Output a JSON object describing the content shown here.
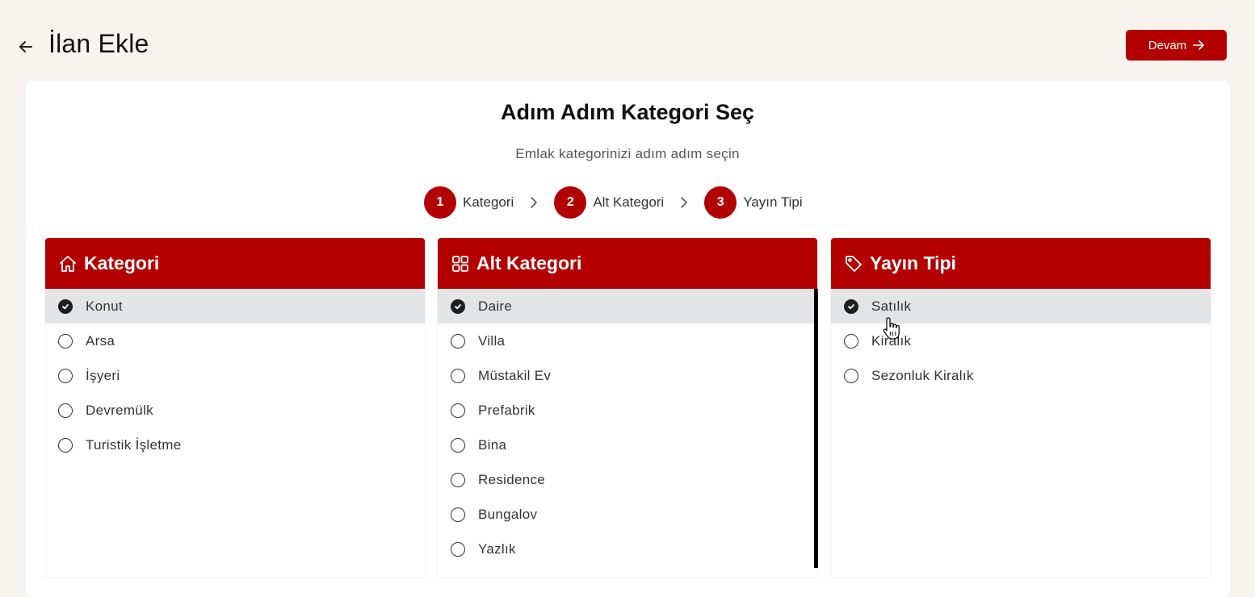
{
  "header": {
    "title": "İlan Ekle",
    "continue_label": "Devam"
  },
  "intro": {
    "heading": "Adım Adım Kategori Seç",
    "subheading": "Emlak kategorinizi adım adım seçin"
  },
  "steps": [
    {
      "number": "1",
      "label": "Kategori"
    },
    {
      "number": "2",
      "label": "Alt Kategori"
    },
    {
      "number": "3",
      "label": "Yayın Tipi"
    }
  ],
  "panels": {
    "category": {
      "title": "Kategori",
      "icon": "home-icon",
      "options": [
        "Konut",
        "Arsa",
        "İşyeri",
        "Devremülk",
        "Turistik İşletme"
      ],
      "selected": "Konut"
    },
    "subcategory": {
      "title": "Alt Kategori",
      "icon": "grid-icon",
      "options": [
        "Daire",
        "Villa",
        "Müstakil Ev",
        "Prefabrik",
        "Bina",
        "Residence",
        "Bungalov",
        "Yazlık"
      ],
      "selected": "Daire"
    },
    "listing_type": {
      "title": "Yayın Tipi",
      "icon": "tag-icon",
      "options": [
        "Satılık",
        "Kiralık",
        "Sezonluk Kiralık"
      ],
      "selected": "Satılık"
    }
  },
  "colors": {
    "accent": "#b30000",
    "background": "#f7f3ef",
    "selected_row": "#e3e4e6"
  }
}
